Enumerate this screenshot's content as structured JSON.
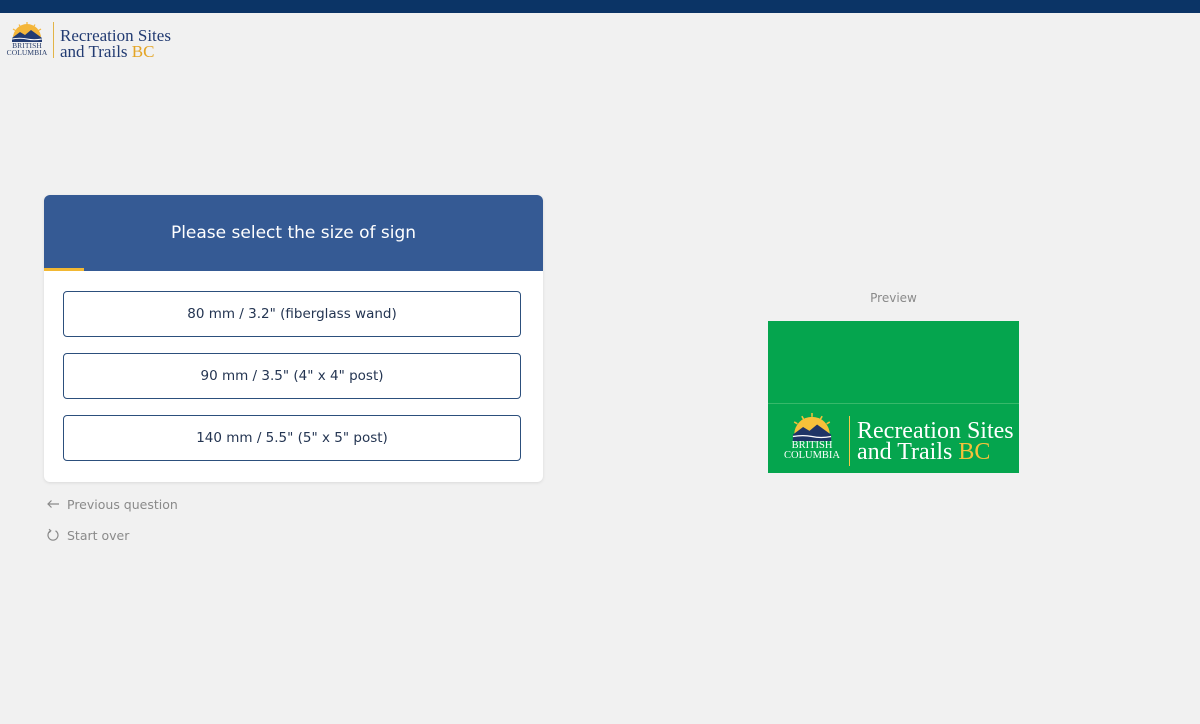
{
  "header": {
    "logo": {
      "word_top": "BRITISH",
      "word_bottom": "COLUMBIA",
      "line1": "Recreation Sites",
      "line2_main": "and Trails",
      "line2_accent": "BC"
    }
  },
  "question": {
    "title": "Please select the size of sign",
    "options": [
      {
        "label": "80 mm / 3.2\" (fiberglass wand)"
      },
      {
        "label": "90 mm / 3.5\" (4\" x 4\" post)"
      },
      {
        "label": "140 mm / 5.5\" (5\" x 5\" post)"
      }
    ]
  },
  "nav": {
    "previous_label": "Previous question",
    "start_over_label": "Start over"
  },
  "preview": {
    "label": "Preview",
    "logo": {
      "word_top": "BRITISH",
      "word_bottom": "COLUMBIA",
      "line1": "Recreation Sites",
      "line2_main": "and Trails",
      "line2_accent": "BC"
    }
  },
  "colors": {
    "top_bar": "#0b3466",
    "card_header": "#355a94",
    "progress_accent": "#f2b833",
    "option_border": "#2c4f7c",
    "preview_green": "#05a54e",
    "brand_gold": "#e4a424"
  },
  "icons": {
    "previous": "arrow-left-icon",
    "start_over": "refresh-icon"
  }
}
